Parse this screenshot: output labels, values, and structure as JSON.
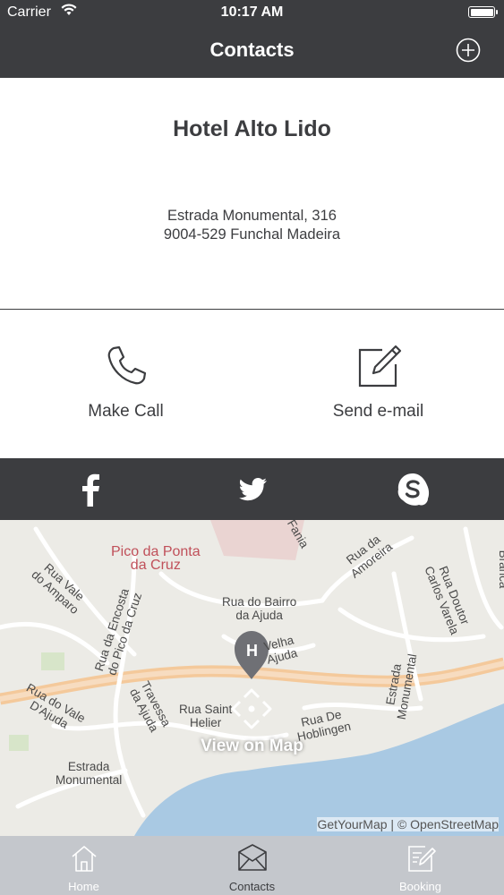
{
  "status": {
    "carrier": "Carrier",
    "time": "10:17 AM"
  },
  "nav": {
    "title": "Contacts"
  },
  "hotel": {
    "name": "Hotel Alto Lido",
    "address_line1": "Estrada Monumental, 316",
    "address_line2": "9004-529 Funchal Madeira"
  },
  "actions": {
    "call_label": "Make Call",
    "email_label": "Send e-mail"
  },
  "map": {
    "view_label": "View on Map",
    "credit": "GetYourMap | © OpenStreetMap",
    "marker_letter": "H",
    "labels": {
      "pico": "Pico da Ponta\nda Cruz",
      "rua_vale_amparo": "Rua Vale\ndo Amparo",
      "encosta": "Rua da Encosta\ndo Pico da Cruz",
      "bairro": "Rua do Bairro\nda Ajuda",
      "velha": "Velha\nAjuda",
      "amoreira": "Rua da\nAmoreira",
      "carlos": "Rua Doutor\nCarlos Varela",
      "branca": "Rua do Cabo\nBranca",
      "vale_ajuda": "Rua do Vale\nD'Ajuda",
      "travessa": "Travessa\nda Ajuda",
      "sao_helier": "Rua Saint\nHelier",
      "estrada_mon": "Estrada\nMonumental",
      "estrada_mon2": "Estrada\nMonumental",
      "dehoblingen": "Rua De\nHoblingen",
      "fania": "Fania"
    }
  },
  "tabs": [
    {
      "label": "Home",
      "icon": "home-icon"
    },
    {
      "label": "Contacts",
      "icon": "envelope-icon"
    },
    {
      "label": "Booking",
      "icon": "edit-icon"
    }
  ],
  "colors": {
    "bar": "#3c3d40",
    "tabbar": "#c4c7cc",
    "sea": "#a9c9e3",
    "text": "#3c3d40"
  }
}
